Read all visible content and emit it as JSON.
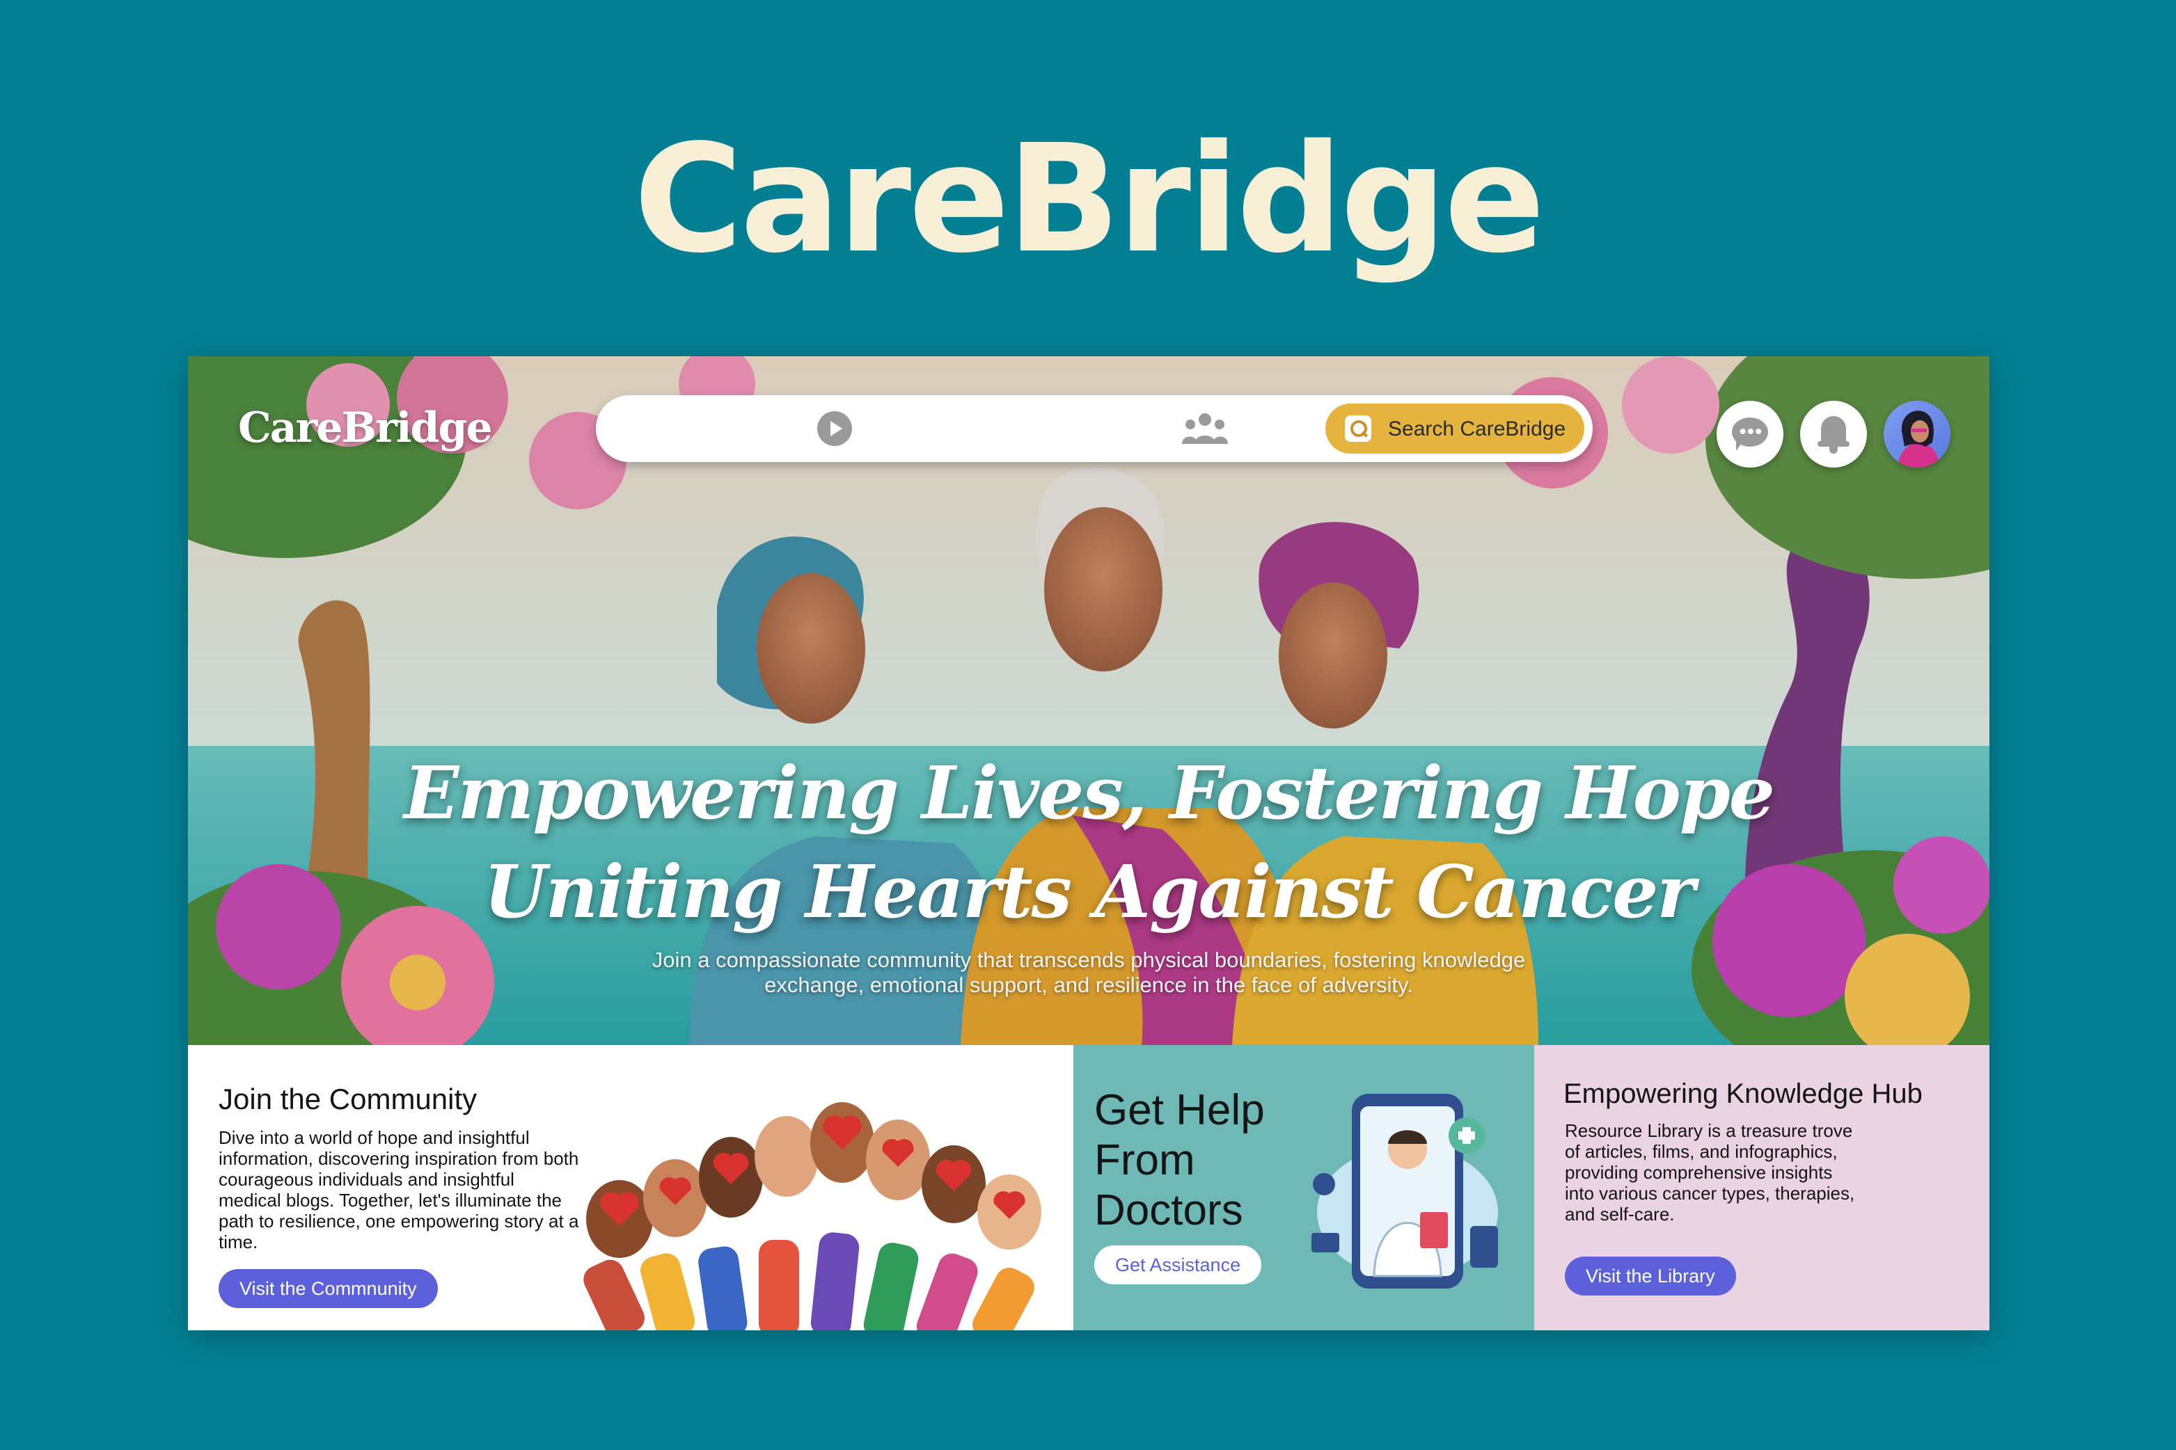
{
  "page": {
    "brand_title": "CareBridge",
    "background_color": "#037F93",
    "title_color": "#F7F0D6"
  },
  "app": {
    "logo": "CareBridge",
    "nav": {
      "icons": [
        "play-icon",
        "community-icon"
      ],
      "search_label": "Search CareBridge",
      "search_button_color": "#E5B43E"
    },
    "header_actions": [
      "chat-icon",
      "bell-icon",
      "avatar"
    ]
  },
  "hero": {
    "headline_line1": "Empowering Lives, Fostering Hope",
    "headline_line2": "Uniting Hearts Against Cancer",
    "subtext": "Join a compassionate community that transcends physical boundaries, fostering knowledge exchange, emotional support, and resilience in the face of adversity."
  },
  "cards": {
    "community": {
      "title": "Join the Community",
      "body": "Dive into a world of hope and insightful information, discovering inspiration from both courageous individuals and insightful medical blogs. Together, let's illuminate the path to resilience, one empowering story at a time.",
      "button": "Visit the Commnunity"
    },
    "doctors": {
      "title": "Get Help From Doctors",
      "button": "Get Assistance",
      "background": "#6EB9B5"
    },
    "hub": {
      "title": "Empowering Knowledge Hub",
      "body": "Resource Library is a treasure trove of articles, films, and infographics, providing comprehensive insights into various cancer types, therapies, and self-care.",
      "button": "Visit the Library",
      "background": "#EAD3E2"
    },
    "button_color": "#5C61DB"
  }
}
